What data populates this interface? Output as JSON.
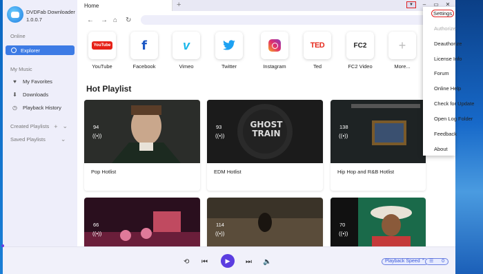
{
  "app": {
    "name": "DVDFab Downloader",
    "version": "1.0.0.7"
  },
  "sidebar": {
    "online_label": "Online",
    "explorer": "Explorer",
    "mymusic_label": "My Music",
    "items": [
      {
        "label": "My Favorites",
        "icon": "heart-icon"
      },
      {
        "label": "Downloads",
        "icon": "download-icon"
      },
      {
        "label": "Playback History",
        "icon": "clock-icon"
      }
    ],
    "created_playlists": "Created Playlists",
    "saved_playlists": "Saved Playlists"
  },
  "tabs": {
    "home": "Home",
    "add": "+"
  },
  "sites": [
    {
      "label": "YouTube",
      "icon": "youtube-icon"
    },
    {
      "label": "Facebook",
      "icon": "facebook-icon"
    },
    {
      "label": "Vimeo",
      "icon": "vimeo-icon"
    },
    {
      "label": "Twitter",
      "icon": "twitter-icon"
    },
    {
      "label": "Instagram",
      "icon": "instagram-icon"
    },
    {
      "label": "Ted",
      "icon": "ted-icon"
    },
    {
      "label": "FC2 Video",
      "icon": "fc2-icon"
    },
    {
      "label": "More...",
      "icon": "plus-icon"
    }
  ],
  "site_logos": {
    "youtube": "YouTube",
    "facebook": "f",
    "vimeo": "v",
    "ted": "TED",
    "fc2": "FC2",
    "more": "+"
  },
  "hot_playlist": {
    "title": "Hot Playlist",
    "cards": [
      {
        "name": "Pop Hotlist",
        "count": "94"
      },
      {
        "name": "EDM Hotlist",
        "count": "93",
        "art_text": "GHOST TRAIN"
      },
      {
        "name": "Hip Hop and R&B Hotlist",
        "count": "138"
      },
      {
        "name": "",
        "count": "66"
      },
      {
        "name": "",
        "count": "114"
      },
      {
        "name": "",
        "count": "70"
      }
    ]
  },
  "menu": {
    "items": [
      {
        "label": "Settings",
        "state": "highlighted"
      },
      {
        "label": "Authorize",
        "state": "disabled"
      },
      {
        "label": "Deauthorize",
        "state": "normal"
      },
      {
        "label": "License Info",
        "state": "normal"
      },
      {
        "label": "Forum",
        "state": "normal"
      },
      {
        "label": "Online Help",
        "state": "normal"
      },
      {
        "label": "Check for Update",
        "state": "normal"
      },
      {
        "label": "Open Log Folder",
        "state": "normal"
      },
      {
        "label": "Feedback",
        "state": "normal"
      },
      {
        "label": "About",
        "state": "normal"
      }
    ]
  },
  "player": {
    "speed_label": "Playback Speed",
    "queue_count": "0"
  },
  "colors": {
    "accent": "#3d7be5",
    "play": "#5b3de0",
    "sidebar_bg": "#eeeefa",
    "highlight": "#e02020"
  }
}
